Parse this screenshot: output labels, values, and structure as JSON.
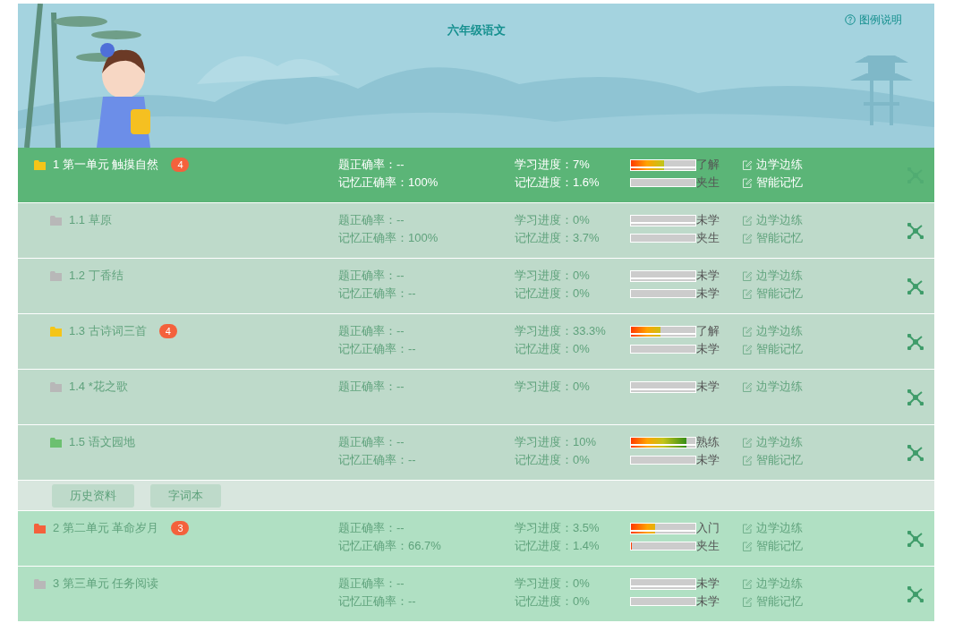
{
  "header": {
    "title": "六年级语文",
    "legend_link": "图例说明"
  },
  "units": [
    {
      "title": "1 第一单元 触摸自然",
      "badge": "4",
      "color": "#f5c518",
      "selected": true,
      "question_accuracy": "题正确率：--",
      "memory_accuracy": "记忆正确率：100%",
      "learn": {
        "text": "学习进度：7%",
        "level": 0.52,
        "grade": "了解"
      },
      "memory": {
        "text": "记忆进度：1.6%",
        "level": 0,
        "grade": "夹生"
      },
      "actions": [
        "边学边练",
        "智能记忆"
      ],
      "children": [
        {
          "title": "1.1 草原",
          "color": "#b8b8b8",
          "selected": false,
          "question_accuracy": "题正确率：--",
          "memory_accuracy": "记忆正确率：100%",
          "learn": {
            "text": "学习进度：0%",
            "level": 0,
            "grade": "未学"
          },
          "memory": {
            "text": "记忆进度：3.7%",
            "level": 0,
            "grade": "夹生"
          },
          "actions": [
            "边学边练",
            "智能记忆"
          ]
        },
        {
          "title": "1.2 丁香结",
          "color": "#b8b8b8",
          "selected": false,
          "question_accuracy": "题正确率：--",
          "memory_accuracy": "记忆正确率：--",
          "learn": {
            "text": "学习进度：0%",
            "level": 0,
            "grade": "未学"
          },
          "memory": {
            "text": "记忆进度：0%",
            "level": 0,
            "grade": "未学"
          },
          "actions": [
            "边学边练",
            "智能记忆"
          ]
        },
        {
          "title": "1.3 古诗词三首",
          "badge": "4",
          "color": "#f5c518",
          "selected": false,
          "question_accuracy": "题正确率：--",
          "memory_accuracy": "记忆正确率：--",
          "learn": {
            "text": "学习进度：33.3%",
            "level": 0.46,
            "grade": "了解"
          },
          "memory": {
            "text": "记忆进度：0%",
            "level": 0,
            "grade": "未学"
          },
          "actions": [
            "边学边练",
            "智能记忆"
          ]
        },
        {
          "title": "1.4 *花之歌",
          "color": "#b8b8b8",
          "selected": false,
          "question_accuracy": "题正确率：--",
          "learn": {
            "text": "学习进度：0%",
            "level": 0,
            "grade": "未学"
          },
          "actions": [
            "边学边练"
          ]
        },
        {
          "title": "1.5 语文园地",
          "color": "#6cc070",
          "selected": false,
          "question_accuracy": "题正确率：--",
          "memory_accuracy": "记忆正确率：--",
          "learn": {
            "text": "学习进度：10%",
            "level": 0.86,
            "grade": "熟练"
          },
          "memory": {
            "text": "记忆进度：0%",
            "level": 0,
            "grade": "未学"
          },
          "actions": [
            "边学边练",
            "智能记忆"
          ]
        }
      ],
      "resources": [
        "历史资料",
        "字词本"
      ]
    },
    {
      "title": "2 第二单元 革命岁月",
      "badge": "3",
      "color": "#f4613c",
      "selected": false,
      "question_accuracy": "题正确率：--",
      "memory_accuracy": "记忆正确率：66.7%",
      "learn": {
        "text": "学习进度：3.5%",
        "level": 0.37,
        "grade": "入门"
      },
      "memory": {
        "text": "记忆进度：1.4%",
        "level": 0.02,
        "grade": "夹生"
      },
      "actions": [
        "边学边练",
        "智能记忆"
      ]
    },
    {
      "title": "3 第三单元 任务阅读",
      "color": "#b8b8b8",
      "selected": false,
      "question_accuracy": "题正确率：--",
      "memory_accuracy": "记忆正确率：--",
      "learn": {
        "text": "学习进度：0%",
        "level": 0,
        "grade": "未学"
      },
      "memory": {
        "text": "记忆进度：0%",
        "level": 0,
        "grade": "未学"
      },
      "actions": [
        "边学边练",
        "智能记忆"
      ]
    }
  ]
}
